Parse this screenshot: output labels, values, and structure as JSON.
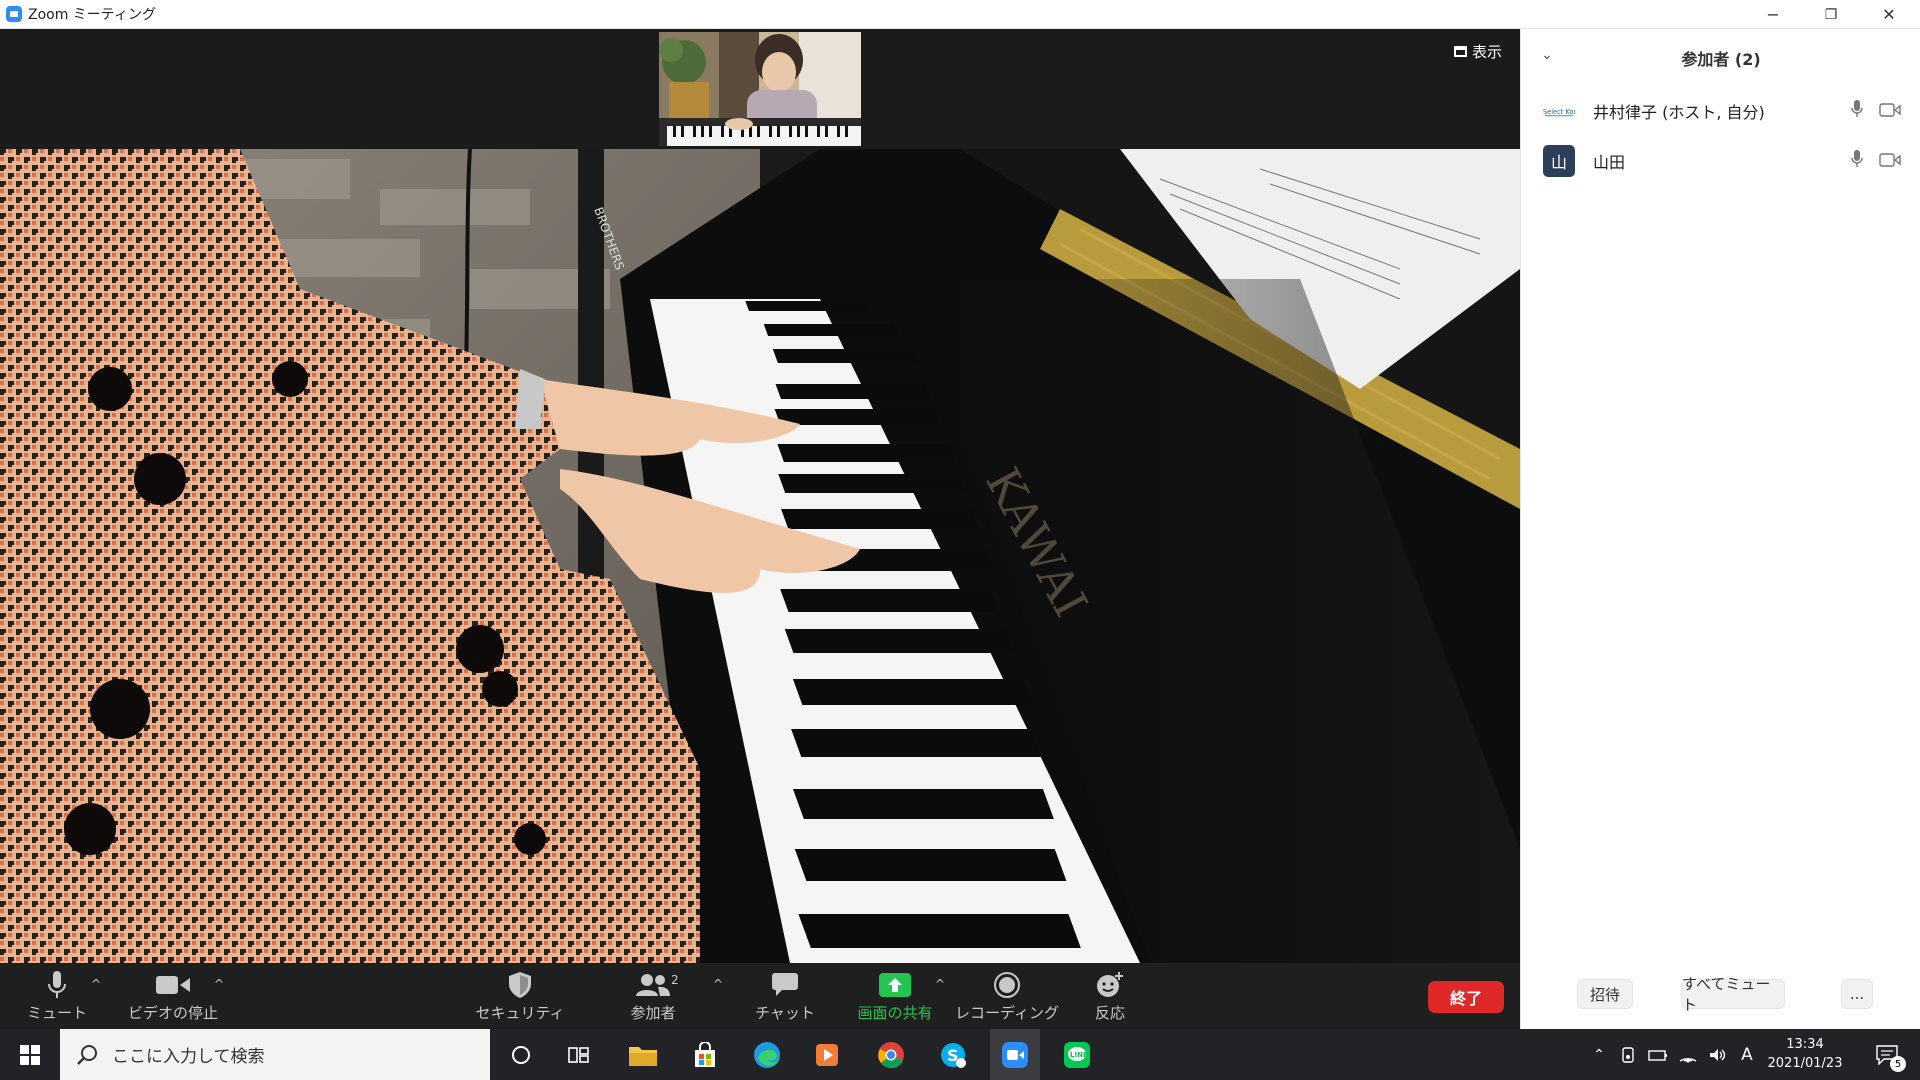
{
  "window": {
    "title": "Zoom ミーティング",
    "controls": {
      "minimize": "−",
      "restore": "❐",
      "close": "✕"
    }
  },
  "video": {
    "view_label": "表示",
    "piano_brand": "KAWAI",
    "stand_label": "BROTHERS"
  },
  "toolbar": {
    "mute_label": "ミュート",
    "video_label": "ビデオの停止",
    "security_label": "セキュリティ",
    "participants_label": "参加者",
    "participants_count": "2",
    "chat_label": "チャット",
    "share_label": "画面の共有",
    "record_label": "レコーディング",
    "reactions_label": "反応",
    "end_label": "終了",
    "caret": "^",
    "colors": {
      "share_green": "#23c552",
      "end_red": "#e02828"
    }
  },
  "panel": {
    "title": "参加者 (2)",
    "participants": [
      {
        "name": "井村律子 (ホスト, 自分)",
        "avatar_type": "logo",
        "logo_text": "Select Kon"
      },
      {
        "name": "山田",
        "avatar_type": "initial",
        "initial": "山",
        "avatar_color": "#2b3f58"
      }
    ],
    "invite_label": "招待",
    "mute_all_label": "すべてミュート",
    "more_label": "..."
  },
  "taskbar": {
    "search_placeholder": "ここに入力して検索",
    "time": "13:34",
    "date": "2021/01/23",
    "ime": "A",
    "notification_count": "5"
  }
}
